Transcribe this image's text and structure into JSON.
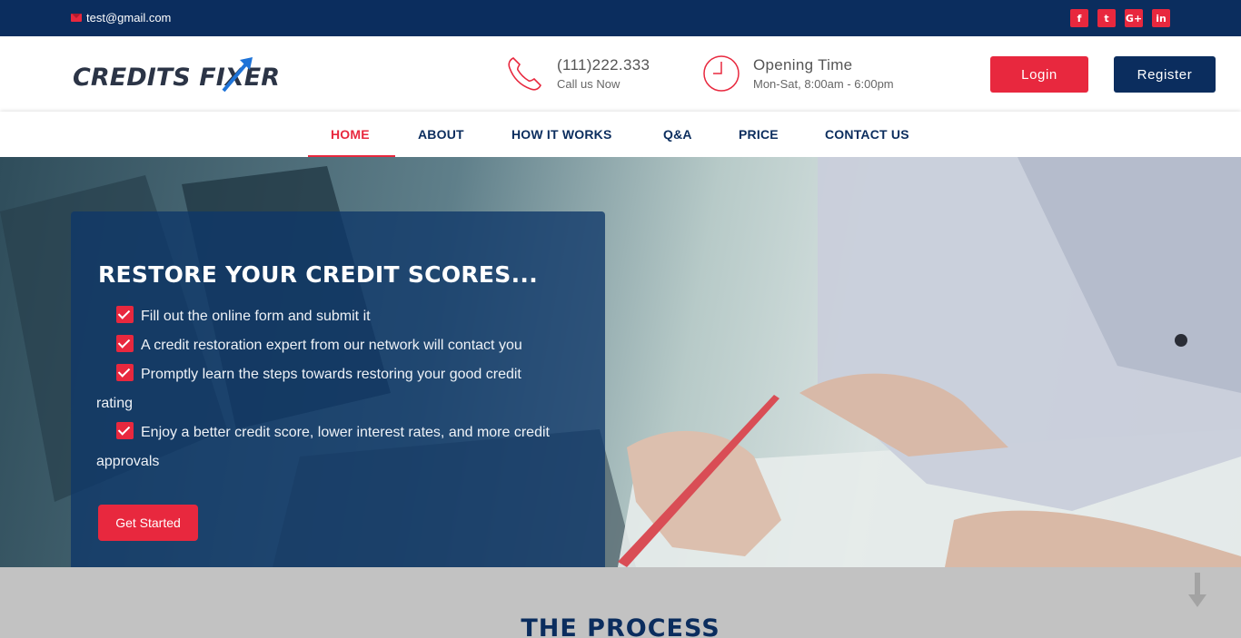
{
  "topbar": {
    "email": "test@gmail.com",
    "social": [
      {
        "icon": "facebook-icon",
        "glyph": "f"
      },
      {
        "icon": "twitter-icon",
        "glyph": "t"
      },
      {
        "icon": "google-plus-icon",
        "glyph": "G+"
      },
      {
        "icon": "linkedin-icon",
        "glyph": "in"
      }
    ]
  },
  "header": {
    "logo_text": "CREDITS FIXER",
    "phone": {
      "icon": "phone-icon",
      "number": "(111)222.333",
      "caption": "Call us Now"
    },
    "hours": {
      "icon": "clock-icon",
      "title": "Opening Time",
      "caption": "Mon-Sat, 8:00am - 6:00pm"
    },
    "login_label": "Login",
    "register_label": "Register"
  },
  "nav": {
    "items": [
      {
        "label": "HOME",
        "active": true
      },
      {
        "label": "ABOUT"
      },
      {
        "label": "HOW IT WORKS"
      },
      {
        "label": "Q&A"
      },
      {
        "label": "PRICE"
      },
      {
        "label": "CONTACT US"
      }
    ]
  },
  "hero": {
    "heading": "RESTORE YOUR CREDIT SCORES...",
    "checklist": [
      {
        "first": "Fill out the online form and submit it",
        "rest": ""
      },
      {
        "first": "A credit restoration expert from our network will contact you",
        "rest": ""
      },
      {
        "first": "Promptly learn the steps towards restoring your good credit",
        "rest": "rating"
      },
      {
        "first": "Enjoy a better credit score, lower interest rates, and more credit",
        "rest": "approvals"
      }
    ],
    "cta_label": "Get Started"
  },
  "process": {
    "heading": "THE PROCESS",
    "scroll_icon": "arrow-down-icon"
  },
  "colors": {
    "navy": "#0b2d5e",
    "red": "#e8283e"
  }
}
